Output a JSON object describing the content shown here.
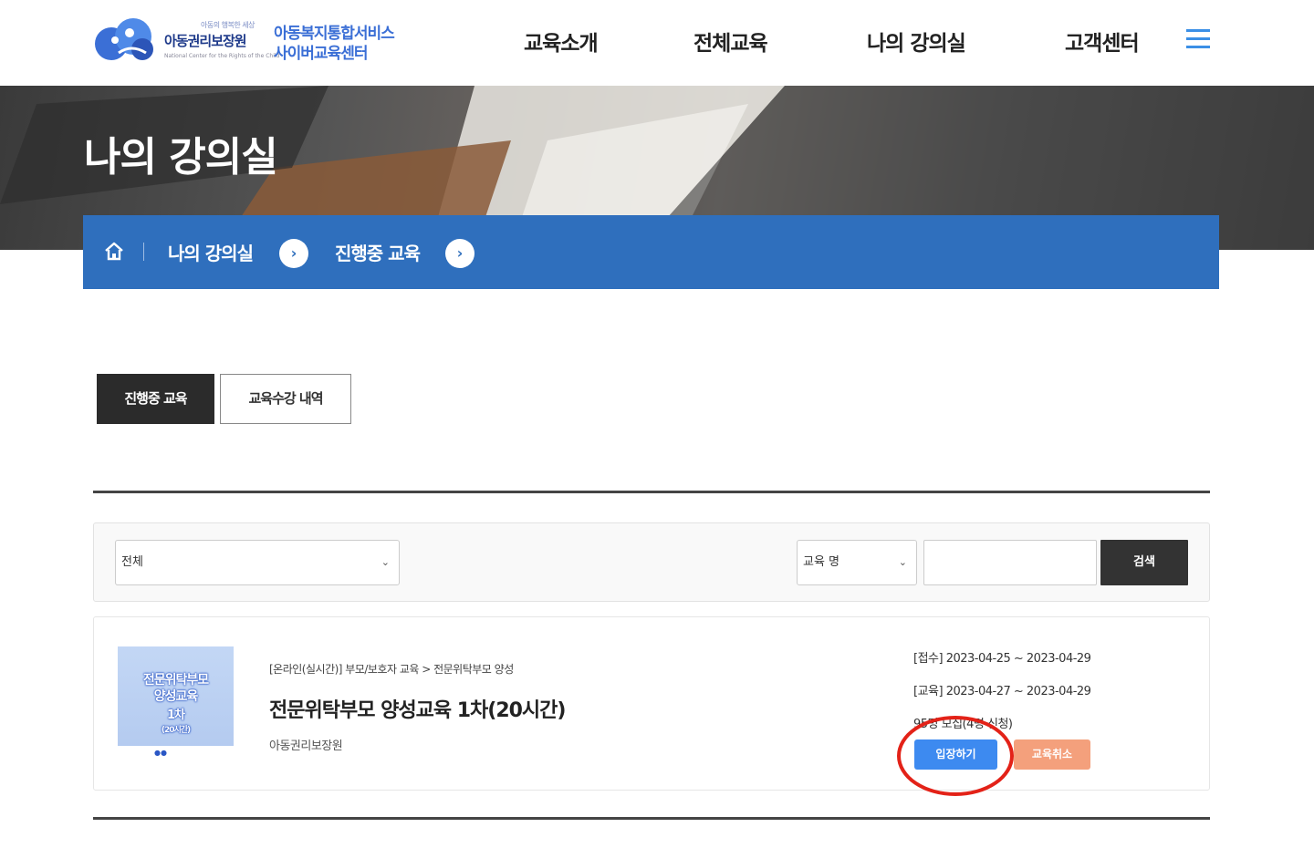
{
  "header": {
    "logo_tagline": "아동의 행복한 세상",
    "logo_org": "아동권리보장원",
    "logo_en": "National Center for the Rights of the Child",
    "logo_service_line1": "아동복지통합서비스",
    "logo_service_line2": "사이버교육센터",
    "nav": [
      "교육소개",
      "전체교육",
      "나의 강의실",
      "고객센터"
    ]
  },
  "hero": {
    "title": "나의 강의실"
  },
  "breadcrumb": {
    "items": [
      "나의 강의실",
      "진행중 교육"
    ]
  },
  "tabs": [
    {
      "label": "진행중 교육",
      "active": true
    },
    {
      "label": "교육수강 내역",
      "active": false
    }
  ],
  "search": {
    "category_selected": "전체",
    "field_selected": "교육 명",
    "query": "",
    "button_label": "검색"
  },
  "course": {
    "thumbnail_lines": [
      "전문위탁부모",
      "양성교육",
      "1차",
      "(20시간)"
    ],
    "category_path": "[온라인(실시간)] 부모/보호자 교육 > 전문위탁부모 양성",
    "title": "전문위탁부모 양성교육 1차(20시간)",
    "provider": "아동권리보장원",
    "apply_period": "[접수] 2023-04-25 ~ 2023-04-29",
    "edu_period": "[교육] 2023-04-27 ~ 2023-04-29",
    "quota": "95명 모집(4명 신청)",
    "enter_label": "입장하기",
    "cancel_label": "교육취소"
  },
  "colors": {
    "breadcrumb_bg": "#2f6fbd",
    "enter_button": "#3d8af0",
    "cancel_button": "#f4a07c",
    "highlight_circle": "#e32218"
  }
}
